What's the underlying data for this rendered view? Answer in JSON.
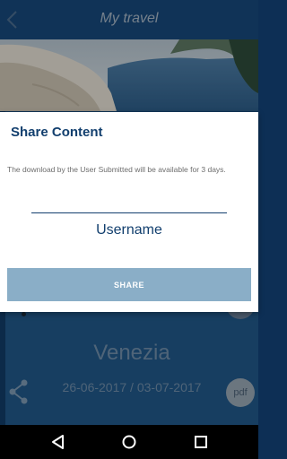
{
  "app": {
    "title": "My travel"
  },
  "trip": {
    "city": "Venezia",
    "dates": "26-06-2017 / 03-07-2017",
    "pdf_label": "pdf"
  },
  "dialog": {
    "title": "Share Content",
    "message": "The download by the User Submitted will be available for 3 days.",
    "username_value": "",
    "username_label": "Username",
    "share_label": "SHARE"
  },
  "icons": {
    "back": "chevron-left-icon",
    "share": "share-icon",
    "nav_back": "triangle-back-icon",
    "nav_home": "circle-home-icon",
    "nav_recents": "square-recents-icon"
  },
  "colors": {
    "brand": "#123f6e",
    "button": "#8aaec7",
    "app_bg": "#1b4f7f"
  }
}
